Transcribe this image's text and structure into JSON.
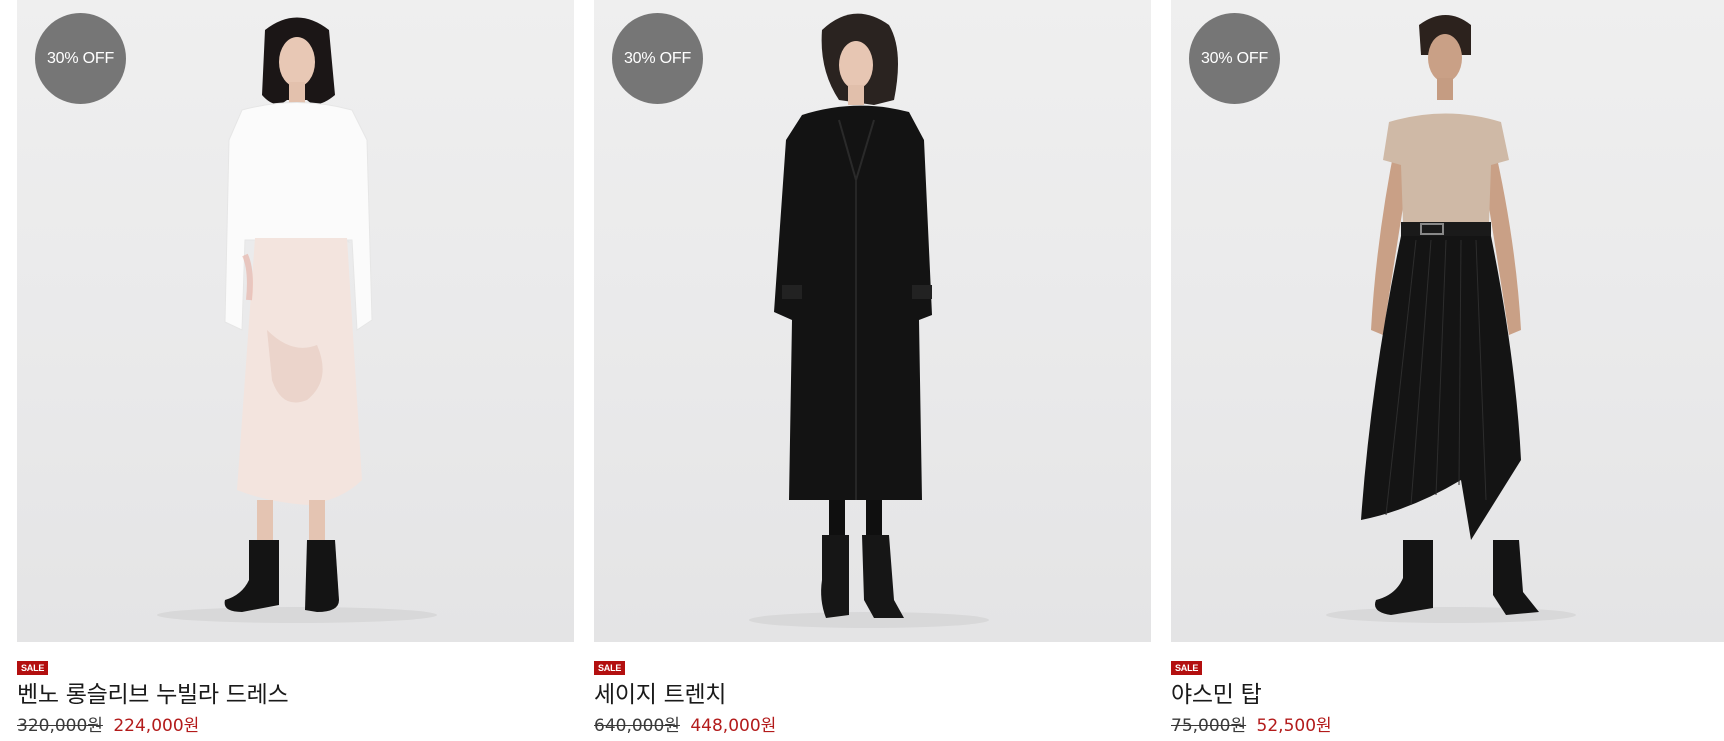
{
  "products": [
    {
      "badge": "30% OFF",
      "sale_label": "SALE",
      "name": "벤노 롱슬리브 누빌라 드레스",
      "original_price": "320,000원",
      "sale_price": "224,000원"
    },
    {
      "badge": "30% OFF",
      "sale_label": "SALE",
      "name": "세이지 트렌치",
      "original_price": "640,000원",
      "sale_price": "448,000원"
    },
    {
      "badge": "30% OFF",
      "sale_label": "SALE",
      "name": "야스민 탑",
      "original_price": "75,000원",
      "sale_price": "52,500원"
    }
  ],
  "colors": {
    "badge_bg": "#767676",
    "sale_tag_bg": "#b30f0f",
    "sale_price": "#b31b1b",
    "image_bg": "#ebebec"
  }
}
